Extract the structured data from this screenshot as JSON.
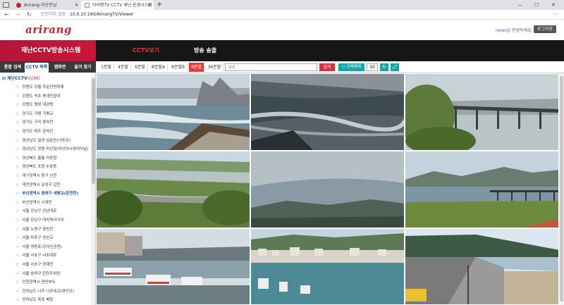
{
  "browser": {
    "tabs": [
      {
        "title": "Arirang-이산진님",
        "active": false
      },
      {
        "title": "아리랑TV CCTV 재난 운영시스템",
        "active": true
      }
    ],
    "new_tab": "+",
    "security_label": "안전하지 않음",
    "url": "10.0.10.190/ArirangTV/Viewer"
  },
  "header": {
    "logo": "arirang",
    "greeting_user": "news",
    "greeting_text": "님 안녕하세요.",
    "logout_label": "로그아웃"
  },
  "topnav": {
    "brand": "재난CCTV방송시스템",
    "menu": [
      {
        "label": "CCTV보기",
        "active": true
      },
      {
        "label": "방송 송출",
        "active": false
      }
    ]
  },
  "sidebar": {
    "tabs": [
      {
        "label": "통합 검색",
        "active": false
      },
      {
        "label": "CCTV 목록",
        "active": true
      },
      {
        "label": "맵화면",
        "active": false
      },
      {
        "label": "즐겨 찾기",
        "active": false
      }
    ],
    "root_label": "재난CCTV",
    "root_count": "(0/36)",
    "items": [
      "강원도 강릉 주문진방파제",
      "강원도 속초 동대진항대",
      "강원도 평창 대관령",
      "경기도 가평 가평교",
      "경기도 구리 왕숙천",
      "경기도 파주 감악산",
      "경상남도 밀양 삼문진(낙동강)",
      "경상남도 창원 마산항(마산어시장터미널)",
      "경상북도 울릉 저동항",
      "경상북도 포항 두호동",
      "대구광역시 동구 신천",
      "대전광역시 유성구 갑천",
      "부산광역시 동래구 세병교(온천천)",
      "부산광역시 수영만",
      "서울 강남구 강남대로",
      "서울 강남구 대치역사거리",
      "서울 노원구 중랑천",
      "서울 마포구 성산교",
      "서울 영등포(강서신공원)",
      "서울 서초구 서초대로",
      "서울 서초구 양재천",
      "서울 송파구 탄천주차장",
      "인천광역시 연안부두",
      "전라남도 나주 나주대교(영산강)",
      "전라남도 목포 북항"
    ]
  },
  "toolbar": {
    "grid_options": [
      {
        "label": "1분할",
        "active": false
      },
      {
        "label": "4분할",
        "active": false
      },
      {
        "label": "6분할",
        "active": false
      },
      {
        "label": "8분할A",
        "active": false
      },
      {
        "label": "8분할B",
        "active": false
      },
      {
        "label": "9분할",
        "active": true
      },
      {
        "label": "36분할",
        "active": false
      }
    ],
    "search_placeholder": "검색",
    "search_label": "검색",
    "select_all_label": "전체해제",
    "count_value": "10",
    "refresh_icon": "refresh-icon",
    "expand_icon": "expand-icon"
  },
  "colors": {
    "brand": "#d12032",
    "accent_teal": "#1aa5a5",
    "nav_bg": "#161616"
  },
  "cameras": [
    {
      "name": "coast-breakwater"
    },
    {
      "name": "rocky-sea"
    },
    {
      "name": "river-bridge"
    },
    {
      "name": "riverside-park"
    },
    {
      "name": "mountain-sky"
    },
    {
      "name": "river-railway-bridge"
    },
    {
      "name": "harbor-boats"
    },
    {
      "name": "port-town"
    },
    {
      "name": "coastal-road"
    }
  ]
}
